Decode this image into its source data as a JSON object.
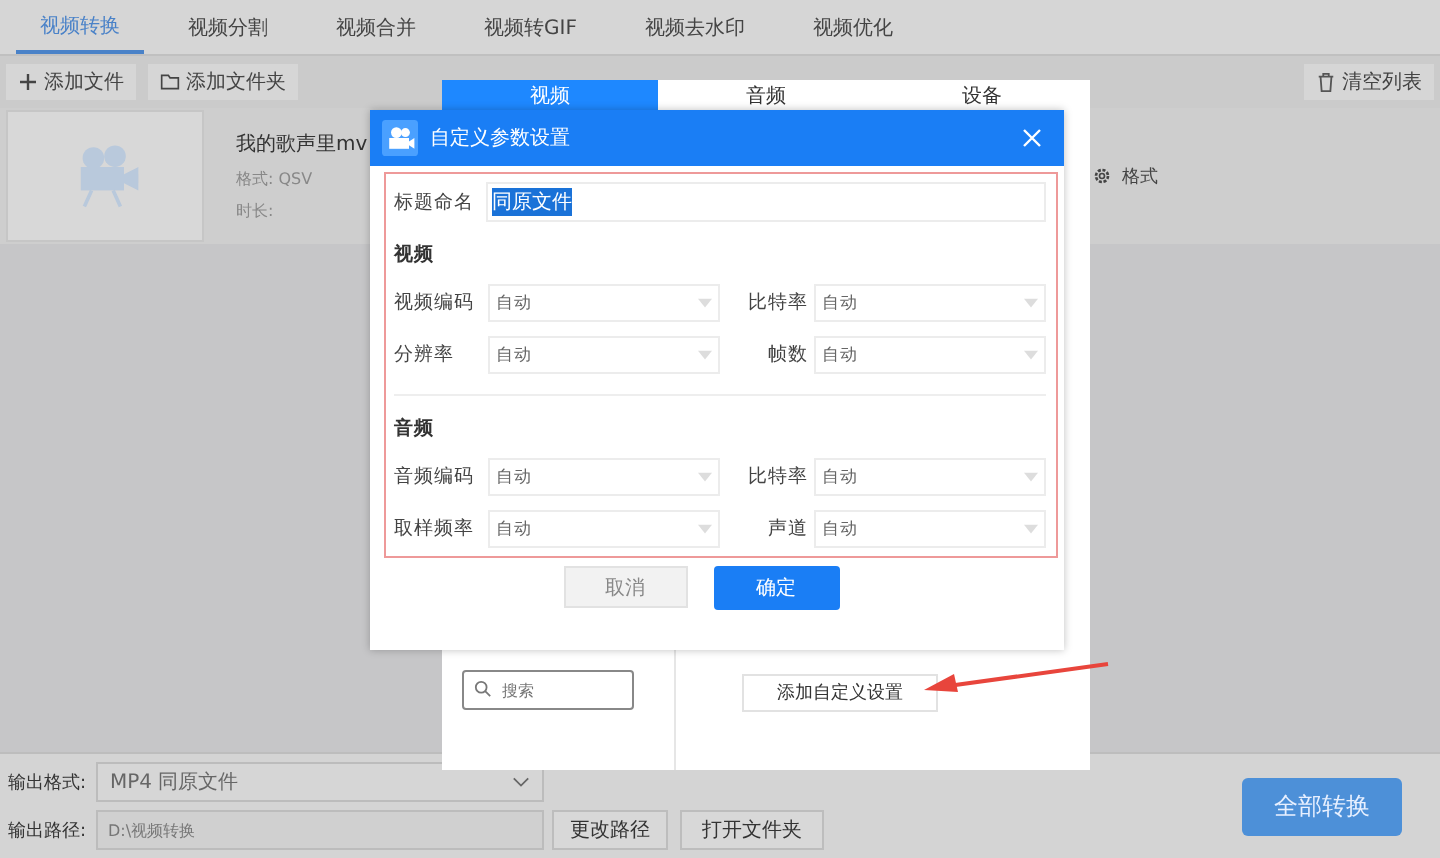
{
  "tabs": [
    {
      "label": "视频转换",
      "selected": true
    },
    {
      "label": "视频分割",
      "selected": false
    },
    {
      "label": "视频合并",
      "selected": false
    },
    {
      "label": "视频转GIF",
      "selected": false
    },
    {
      "label": "视频去水印",
      "selected": false
    },
    {
      "label": "视频优化",
      "selected": false
    }
  ],
  "toolbar": {
    "add_file": "添加文件",
    "add_folder": "添加文件夹",
    "clear_list": "清空列表"
  },
  "file": {
    "name": "我的歌声里mv",
    "format": "格式: QSV",
    "duration": "时长:",
    "format_button": "格式"
  },
  "format_panel": {
    "tabs": [
      {
        "label": "视频",
        "selected": true
      },
      {
        "label": "音频",
        "selected": false
      },
      {
        "label": "设备",
        "selected": false
      }
    ],
    "search": {
      "placeholder": "搜索"
    },
    "add_button": "添加自定义设置"
  },
  "dialog": {
    "title": "自定义参数设置",
    "name_label": "标题命名",
    "name_value": "同原文件",
    "sections": [
      {
        "title": "视频",
        "fields": [
          {
            "label": "视频编码",
            "value": "自动"
          },
          {
            "label": "比特率",
            "value": "自动"
          },
          {
            "label": "分辨率",
            "value": "自动"
          },
          {
            "label": "帧数",
            "value": "自动"
          }
        ]
      },
      {
        "title": "音频",
        "fields": [
          {
            "label": "音频编码",
            "value": "自动"
          },
          {
            "label": "比特率",
            "value": "自动"
          },
          {
            "label": "取样频率",
            "value": "自动"
          },
          {
            "label": "声道",
            "value": "自动"
          }
        ]
      }
    ],
    "cancel": "取消",
    "ok": "确定"
  },
  "output": {
    "format_label": "输出格式:",
    "format_value": "MP4  同原文件",
    "path_label": "输出路径:",
    "path_value": "D:\\视频转换",
    "change_path": "更改路径",
    "open_folder": "打开文件夹",
    "convert_all": "全部转换"
  }
}
